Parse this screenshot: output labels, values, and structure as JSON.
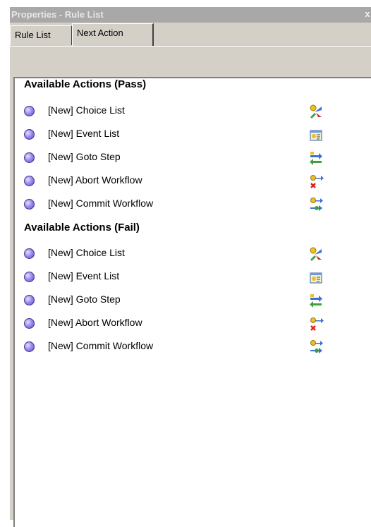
{
  "window": {
    "title": "Properties - Rule List",
    "close_glyph": "x"
  },
  "tabs": [
    {
      "label": "Rule List",
      "active": false
    },
    {
      "label": "Next Action",
      "active": true
    }
  ],
  "sections": [
    {
      "title": "Available Actions (Pass)",
      "items": [
        {
          "label": "[New] Choice List",
          "icon": "choice-list-icon"
        },
        {
          "label": "[New] Event List",
          "icon": "event-list-icon"
        },
        {
          "label": "[New] Goto Step",
          "icon": "goto-step-icon"
        },
        {
          "label": "[New] Abort Workflow",
          "icon": "abort-workflow-icon"
        },
        {
          "label": "[New] Commit Workflow",
          "icon": "commit-workflow-icon"
        }
      ]
    },
    {
      "title": "Available Actions (Fail)",
      "items": [
        {
          "label": "[New] Choice List",
          "icon": "choice-list-icon"
        },
        {
          "label": "[New] Event List",
          "icon": "event-list-icon"
        },
        {
          "label": "[New] Goto Step",
          "icon": "goto-step-icon"
        },
        {
          "label": "[New] Abort Workflow",
          "icon": "abort-workflow-icon"
        },
        {
          "label": "[New] Commit Workflow",
          "icon": "commit-workflow-icon"
        }
      ]
    }
  ],
  "colors": {
    "titlebar": "#a8a8a8",
    "face": "#d4d0c8",
    "bullet": "#8f82ea"
  }
}
